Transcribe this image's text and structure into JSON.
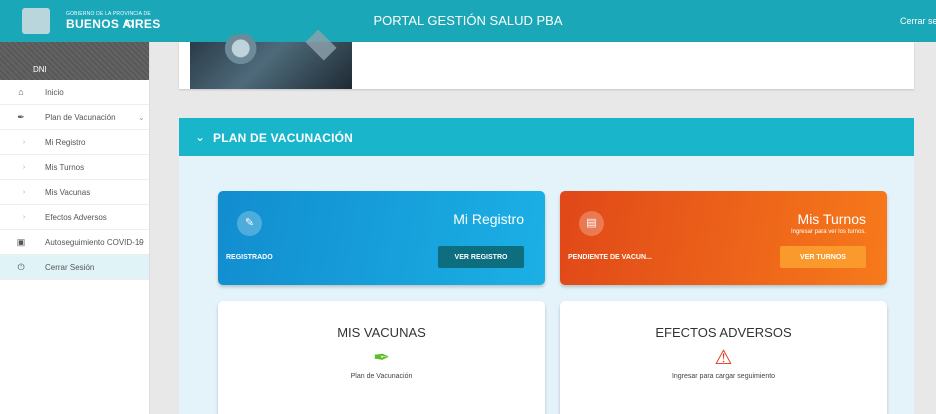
{
  "header": {
    "logo_small_text": "GOBIERNO DE LA PROVINCIA DE",
    "logo_text": "BUENOS AIRES",
    "title": "PORTAL GESTIÓN SALUD PBA",
    "logout_label": "Cerrar sesi"
  },
  "sidebar": {
    "user_label": "DNI",
    "items": [
      {
        "label": "Inicio",
        "icon": "home-icon"
      },
      {
        "label": "Plan de Vacunación",
        "icon": "syringe-icon"
      },
      {
        "label": "Mi Registro",
        "icon": "chevron-right-icon"
      },
      {
        "label": "Mis Turnos",
        "icon": "chevron-right-icon"
      },
      {
        "label": "Mis Vacunas",
        "icon": "chevron-right-icon"
      },
      {
        "label": "Efectos Adversos",
        "icon": "chevron-right-icon"
      },
      {
        "label": "Autoseguimiento COVID-19",
        "icon": "calendar-icon"
      },
      {
        "label": "Cerrar Sesión",
        "icon": "power-icon"
      }
    ]
  },
  "plan": {
    "title": "PLAN DE VACUNACIÓN",
    "registro": {
      "title": "Mi Registro",
      "status": "REGISTRADO",
      "button": "VER REGISTRO"
    },
    "turnos": {
      "title": "Mis Turnos",
      "subtitle": "Ingresar para ver los turnos.",
      "status": "PENDIENTE DE VACUN...",
      "button": "VER TURNOS"
    },
    "vacunas": {
      "title": "MIS VACUNAS",
      "subtitle": "Plan de Vacunación"
    },
    "adversos": {
      "title": "EFECTOS ADVERSOS",
      "subtitle": "Ingresar para cargar seguimiento"
    }
  },
  "colors": {
    "header": "#1aa7b7",
    "plan_header": "#19b5cb",
    "card_blue": "#128dcf",
    "card_orange": "#f77a1b",
    "button_teal": "#0d6e80",
    "button_orange": "#fb9a2c"
  }
}
